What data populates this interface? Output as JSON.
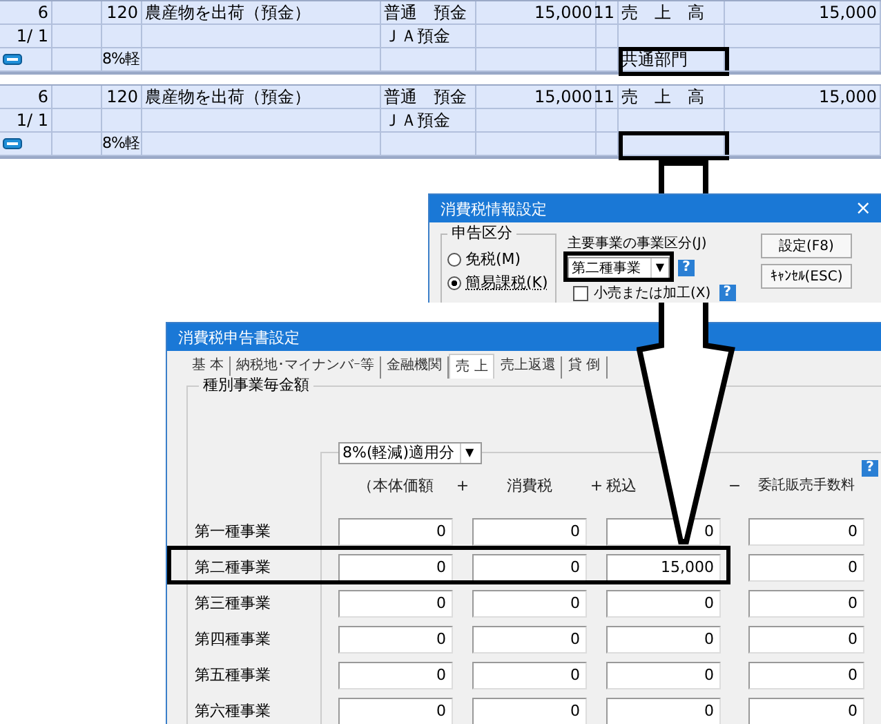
{
  "journal_entries": [
    {
      "no": "6",
      "code": "120",
      "description": "農産物を出荷（預金）",
      "debit_account": "普通　預金",
      "debit_amount": "15,000",
      "credit_code": "11",
      "credit_account": "売　上　高",
      "credit_amount": "15,000",
      "date": "1/ 1",
      "debit_sub": "ＪＡ預金",
      "tax": "8%軽",
      "department": "共通部門"
    },
    {
      "no": "6",
      "code": "120",
      "description": "農産物を出荷（預金）",
      "debit_account": "普通　預金",
      "debit_amount": "15,000",
      "credit_code": "11",
      "credit_account": "売　上　高",
      "credit_amount": "15,000",
      "date": "1/ 1",
      "debit_sub": "ＪＡ預金",
      "tax": "8%軽"
    }
  ],
  "info_dialog": {
    "title": "消費税情報設定",
    "close": "×",
    "filing_group": {
      "label": "申告区分",
      "options": [
        {
          "label": "免税(M)",
          "selected": false
        },
        {
          "label": "簡易課税(K)",
          "selected": true
        }
      ]
    },
    "main_business": {
      "label": "主要事業の事業区分(J)",
      "value": "第二種事業",
      "arrow": "▼",
      "help": "?"
    },
    "retail_checkbox": {
      "label": "小売または加工(X)",
      "checked": false,
      "help": "?"
    },
    "buttons": [
      "設定(F8)",
      "ｷｬﾝｾﾙ(ESC)"
    ]
  },
  "return_dialog": {
    "title": "消費税申告書設定",
    "tabs": [
      {
        "label": "基 本",
        "selected": false
      },
      {
        "label": "納税地･マイナンバｰ等",
        "selected": false
      },
      {
        "label": "金融機関",
        "selected": false
      },
      {
        "label": "売 上",
        "selected": true
      },
      {
        "label": "売上返還",
        "selected": false
      },
      {
        "label": "貸 倒",
        "selected": false
      }
    ],
    "group_label": "種別事業毎金額",
    "rate_select": "8%(軽減)適用分",
    "rate_select_arrow": "▼",
    "help": "?",
    "columns": [
      "（本体価額",
      "+",
      "消費税",
      "+",
      "税込",
      "−",
      "委託販売手数料"
    ],
    "rows": [
      {
        "label": "第一種事業",
        "values": [
          "0",
          "0",
          "0",
          "0"
        ]
      },
      {
        "label": "第二種事業",
        "values": [
          "0",
          "0",
          "15,000",
          "0"
        ]
      },
      {
        "label": "第三種事業",
        "values": [
          "0",
          "0",
          "0",
          "0"
        ]
      },
      {
        "label": "第四種事業",
        "values": [
          "0",
          "0",
          "0",
          "0"
        ]
      },
      {
        "label": "第五種事業",
        "values": [
          "0",
          "0",
          "0",
          "0"
        ]
      },
      {
        "label": "第六種事業",
        "values": [
          "0",
          "0",
          "0",
          "0"
        ]
      }
    ]
  }
}
